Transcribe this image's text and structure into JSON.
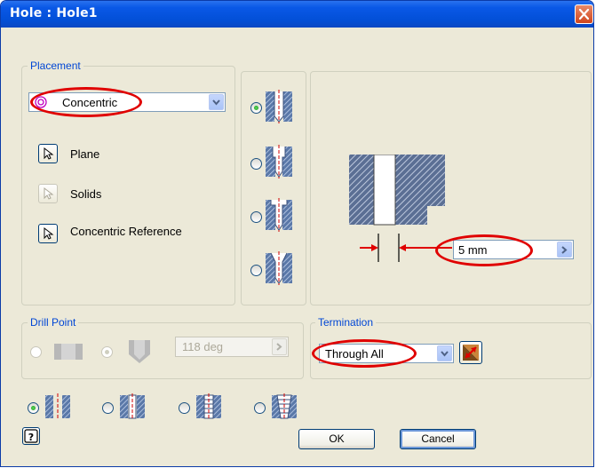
{
  "window": {
    "title": "Hole : Hole1"
  },
  "placement": {
    "group_label": "Placement",
    "type_value": "Concentric",
    "plane_label": "Plane",
    "solids_label": "Solids",
    "concentric_ref_label": "Concentric Reference"
  },
  "hole_type_options": [
    {
      "icon": "drilled-hole-icon",
      "selected": true
    },
    {
      "icon": "counterbore-hole-icon",
      "selected": false
    },
    {
      "icon": "spotface-hole-icon",
      "selected": false
    },
    {
      "icon": "countersink-hole-icon",
      "selected": false
    }
  ],
  "diameter": {
    "value": "5 mm"
  },
  "drill_point": {
    "group_label": "Drill Point",
    "angle_value": "118 deg",
    "enabled": false
  },
  "termination": {
    "group_label": "Termination",
    "value": "Through All"
  },
  "thread_options": [
    {
      "icon": "simple-hole-icon",
      "selected": true
    },
    {
      "icon": "clearance-hole-icon",
      "selected": false
    },
    {
      "icon": "tapped-hole-icon",
      "selected": false
    },
    {
      "icon": "taper-tapped-hole-icon",
      "selected": false
    }
  ],
  "buttons": {
    "ok": "OK",
    "cancel": "Cancel"
  },
  "colors": {
    "title_bar": "#0350d8",
    "annotation": "#e00000",
    "group_label": "#0046d5",
    "dialog_bg": "#ece9d8"
  }
}
